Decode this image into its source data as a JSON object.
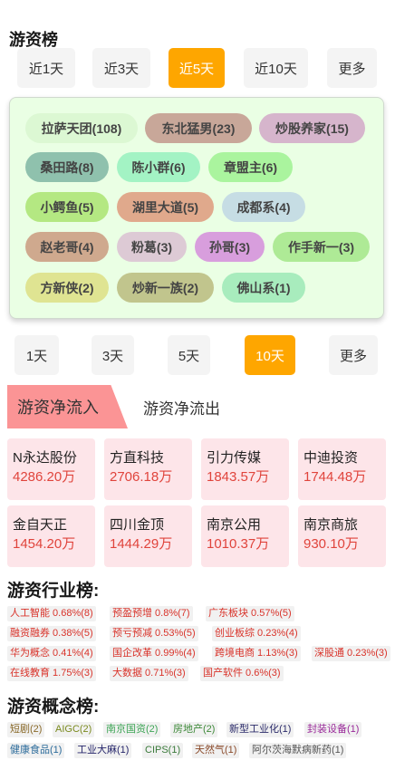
{
  "title": "游资榜",
  "colors": {
    "active_period": "#fea600",
    "tag_panel_bg": "#eaffe4",
    "flow_tab_active": "#fb9495",
    "stock_card_bg": "#fde5e9",
    "amount_red": "#e0443c",
    "industry_red": "#d9332a"
  },
  "period_tabs_top": [
    "近1天",
    "近3天",
    "近5天",
    "近10天",
    "更多"
  ],
  "period_tabs_top_active": "近5天",
  "tags": [
    {
      "label": "拉萨天团(108)",
      "color": "#dcf8d3"
    },
    {
      "label": "东北猛男(23)",
      "color": "#c8a799"
    },
    {
      "label": "炒股养家(15)",
      "color": "#d6b5cc"
    },
    {
      "label": "桑田路(8)",
      "color": "#8fc1ad"
    },
    {
      "label": "陈小群(6)",
      "color": "#a3f3c4"
    },
    {
      "label": "章盟主(6)",
      "color": "#aaf49e"
    },
    {
      "label": "小鳄鱼(5)",
      "color": "#b4e882"
    },
    {
      "label": "湖里大道(5)",
      "color": "#e0a98c"
    },
    {
      "label": "成都系(4)",
      "color": "#c6dde4"
    },
    {
      "label": "赵老哥(4)",
      "color": "#cfa98e"
    },
    {
      "label": "粉葛(3)",
      "color": "#ddcad5"
    },
    {
      "label": "孙哥(3)",
      "color": "#d89edd"
    },
    {
      "label": "作手新一(3)",
      "color": "#aeea96"
    },
    {
      "label": "方新侠(2)",
      "color": "#dfe492"
    },
    {
      "label": "炒新一族(2)",
      "color": "#c1c58d"
    },
    {
      "label": "佛山系(1)",
      "color": "#a8ecbd"
    }
  ],
  "period_tabs_bottom": [
    "1天",
    "3天",
    "5天",
    "10天",
    "更多"
  ],
  "period_tabs_bottom_active": "10天",
  "flow_tabs": {
    "inflow": "游资净流入",
    "outflow": "游资净流出"
  },
  "stocks": [
    {
      "name": "N永达股份",
      "amount": "4286.20万"
    },
    {
      "name": "方直科技",
      "amount": "2706.18万"
    },
    {
      "name": "引力传媒",
      "amount": "1843.57万"
    },
    {
      "name": "中迪投资",
      "amount": "1744.48万"
    },
    {
      "name": "金自天正",
      "amount": "1454.20万"
    },
    {
      "name": "四川金顶",
      "amount": "1444.29万"
    },
    {
      "name": "南京公用",
      "amount": "1010.37万"
    },
    {
      "name": "南京商旅",
      "amount": "930.10万"
    }
  ],
  "industry_title": "游资行业榜:",
  "industry_rows": [
    [
      "人工智能 0.68%(8)",
      "预盈预增 0.8%(7)",
      "广东板块 0.57%(5)"
    ],
    [
      "融资融券 0.38%(5)",
      "预亏预减 0.53%(5)",
      "创业板综 0.23%(4)"
    ],
    [
      "华为概念 0.41%(4)",
      "国企改革 0.99%(4)",
      "跨境电商 1.13%(3)",
      "深股通 0.23%(3)"
    ],
    [
      "在线教育 1.75%(3)",
      "大数据 0.71%(3)",
      "国产软件 0.6%(3)"
    ]
  ],
  "concept_title": "游资概念榜:",
  "concept_rows": [
    [
      {
        "text": "短剧(2)",
        "color": "#8a6a2a"
      },
      {
        "text": "AIGC(2)",
        "color": "#7a8a1e"
      },
      {
        "text": "南京国资(2)",
        "color": "#3ea556"
      },
      {
        "text": "房地产(2)",
        "color": "#3f8a3a"
      },
      {
        "text": "新型工业化(1)",
        "color": "#2b2b6a"
      },
      {
        "text": "封装设备(1)",
        "color": "#9a2a9a"
      }
    ],
    [
      {
        "text": "健康食品(1)",
        "color": "#2a6a9a"
      },
      {
        "text": "工业大麻(1)",
        "color": "#24246a"
      },
      {
        "text": "CIPS(1)",
        "color": "#3a7a3a"
      },
      {
        "text": "天然气(1)",
        "color": "#8a4a2a"
      },
      {
        "text": "阿尔茨海默病新药(1)",
        "color": "#555555"
      }
    ]
  ]
}
